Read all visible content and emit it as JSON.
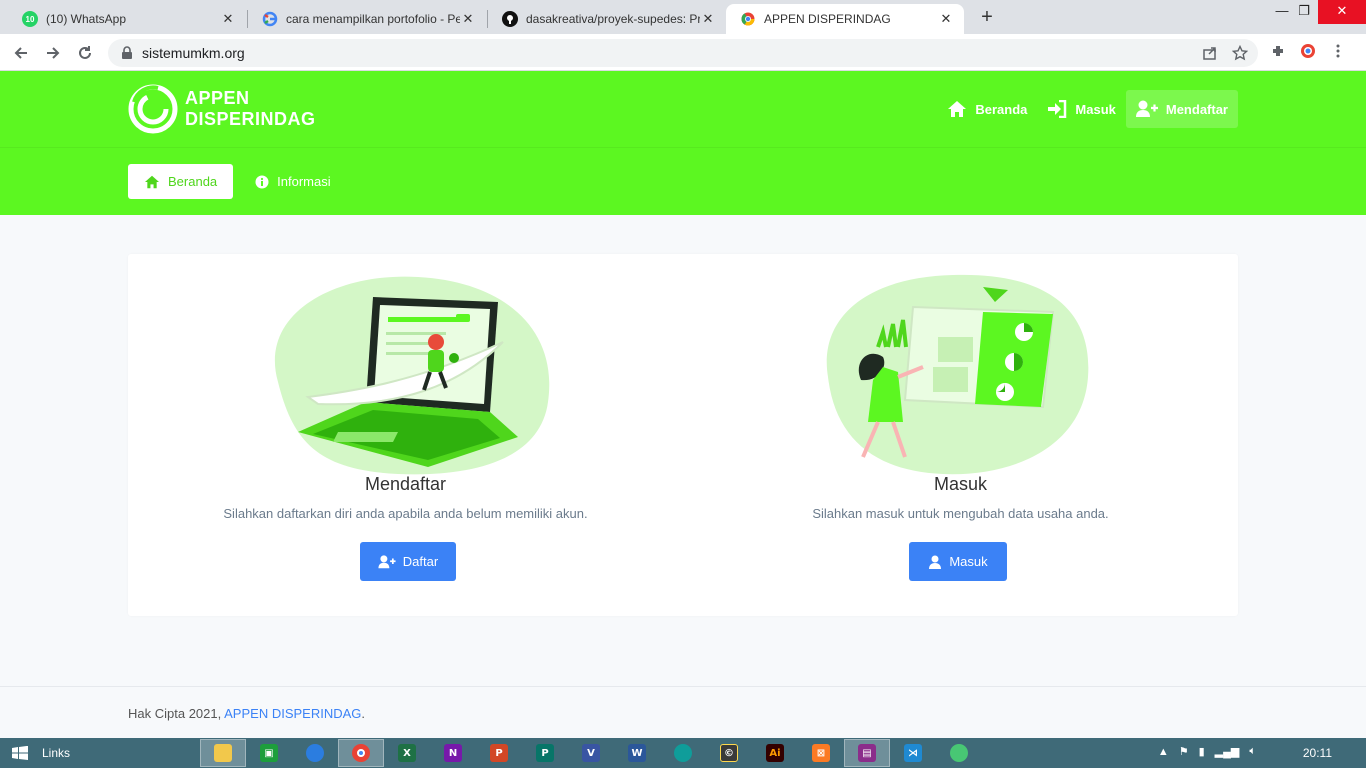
{
  "browser": {
    "tabs": [
      {
        "title": "(10) WhatsApp",
        "icon": "whatsapp-icon",
        "color": "#25d366"
      },
      {
        "title": "cara menampilkan portofolio - Pe",
        "icon": "google-icon",
        "color": "#4285f4"
      },
      {
        "title": "dasakreativa/proyek-supedes: Pro",
        "icon": "github-icon",
        "color": "#111111"
      },
      {
        "title": "APPEN DISPERINDAG",
        "icon": "chrome-icon",
        "color": "#e94235"
      }
    ],
    "new_tab": "+",
    "url": "sistemumkm.org"
  },
  "site": {
    "brand_line1": "APPEN",
    "brand_line2": "DISPERINDAG",
    "topnav": [
      {
        "label": "Beranda",
        "icon": "home-icon"
      },
      {
        "label": "Masuk",
        "icon": "sign-in-icon"
      },
      {
        "label": "Mendaftar",
        "icon": "user-plus-icon"
      }
    ],
    "subnav": [
      {
        "label": "Beranda",
        "icon": "home-icon"
      },
      {
        "label": "Informasi",
        "icon": "info-circle-icon"
      }
    ],
    "accent": "#5cf721",
    "button_color": "#3b82f6"
  },
  "main": {
    "register": {
      "title": "Mendaftar",
      "desc": "Silahkan daftarkan diri anda apabila anda belum memiliki akun.",
      "button": "Daftar"
    },
    "login": {
      "title": "Masuk",
      "desc": "Silahkan masuk untuk mengubah data usaha anda.",
      "button": "Masuk"
    }
  },
  "footer": {
    "prefix": "Hak Cipta 2021,",
    "link": "APPEN DISPERINDAG",
    "suffix": "."
  },
  "taskbar": {
    "links_label": "Links",
    "apps": [
      "file-explorer-icon",
      "excel-icon",
      "firefox-icon",
      "chrome-icon",
      "excel-icon",
      "onenote-icon",
      "powerpoint-icon",
      "publisher-icon",
      "visio-icon",
      "word-icon",
      "edge-icon",
      "calculator-icon",
      "illustrator-icon",
      "xampp-icon",
      "winrar-icon",
      "vscode-icon",
      "app-icon"
    ],
    "clock": "20:11"
  }
}
